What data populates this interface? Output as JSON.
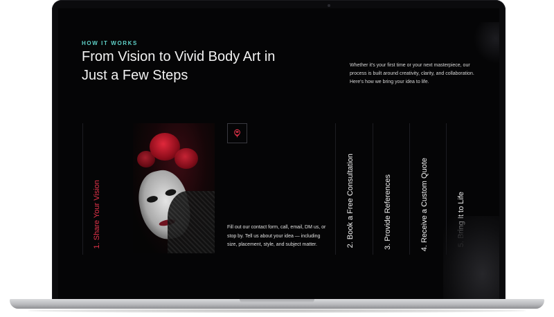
{
  "section": {
    "eyebrow": "HOW IT WORKS",
    "heading": "From Vision to Vivid Body Art in Just a Few Steps",
    "intro": "Whether it's your first time or your next masterpiece, our process is built around creativity, clarity, and collaboration. Here's how we bring your idea to life."
  },
  "steps": [
    {
      "label": "1. Share Your Vision",
      "active": true,
      "description": "Fill out our contact form, call, email, DM us, or stop by. Tell us about your idea — including size, placement, style, and subject matter."
    },
    {
      "label": "2. Book a Free Consultation",
      "active": false
    },
    {
      "label": "3. Provide References",
      "active": false
    },
    {
      "label": "4. Receive a Custom Quote",
      "active": false
    },
    {
      "label": "5. Bring It to Life",
      "active": false
    }
  ],
  "icons": {
    "step_icon": "rose-icon"
  },
  "colors": {
    "accent": "#e3334a",
    "eyebrow": "#5fd1c8",
    "background": "#050506"
  }
}
